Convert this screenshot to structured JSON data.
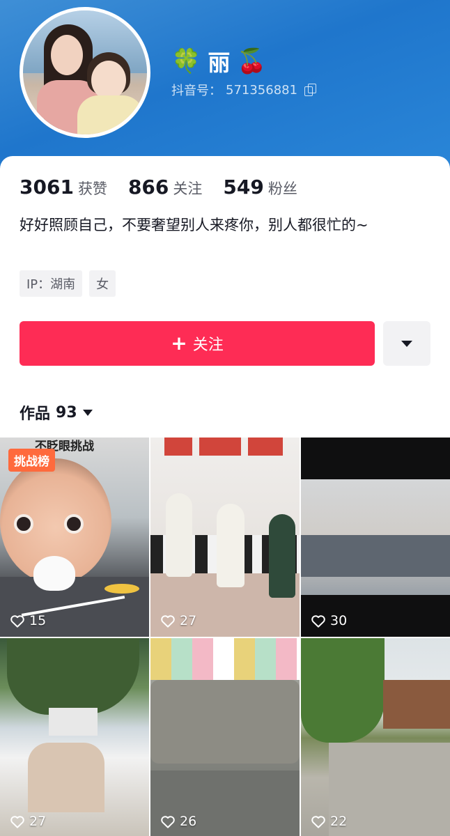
{
  "profile": {
    "name_prefix_emoji": "🍀",
    "name": "丽",
    "name_suffix_emoji": "🍒",
    "douyin_id_label": "抖音号：",
    "douyin_id": "571356881"
  },
  "stats": [
    {
      "value": "3061",
      "label": "获赞"
    },
    {
      "value": "866",
      "label": "关注"
    },
    {
      "value": "549",
      "label": "粉丝"
    }
  ],
  "bio": "好好照顾自己，不要奢望别人来疼你，别人都很忙的~",
  "tags": [
    "IP：湖南",
    "女"
  ],
  "actions": {
    "follow_label": "关注",
    "follow_color": "#fe2c55"
  },
  "works_tab": {
    "label": "作品",
    "count": "93"
  },
  "videos": [
    {
      "likes": "15",
      "badge": "挑战榜",
      "overlay_text": "不眨眼挑战"
    },
    {
      "likes": "27"
    },
    {
      "likes": "30"
    },
    {
      "likes": "27"
    },
    {
      "likes": "26"
    },
    {
      "likes": "22"
    }
  ],
  "colors": {
    "header_bg": "#1f76cc",
    "accent": "#fe2c55"
  }
}
